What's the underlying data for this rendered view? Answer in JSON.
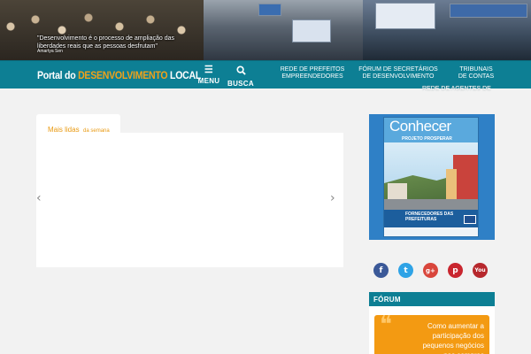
{
  "hero": {
    "quote": "\"Desenvolvimento é o processo de ampliação das liberdades reais que as pessoas desfrutam\"",
    "author": "Amartya Sen"
  },
  "navbar": {
    "logo_prefix": "Portal do ",
    "logo_accent": "DESENVOLVIMENTO",
    "logo_suffix": " LOCAL",
    "menu_label": "MENU",
    "menu_icon": "hamburger-icon",
    "search_label": "BUSCA",
    "search_icon": "search-icon",
    "links": [
      {
        "line1": "REDE DE PREFEITOS",
        "line2": "EMPREENDEDORES"
      },
      {
        "line1": "FÓRUM DE SECRETÁRIOS",
        "line2": "DE DESENVOLVIMENTO"
      },
      {
        "line1": "TRIBUNAIS",
        "line2": "DE CONTAS"
      }
    ],
    "overflow_link": "REDE DE AGENTES DE"
  },
  "most_read": {
    "tab_title": "Mais lidas",
    "tab_subtitle": "da semana"
  },
  "carousel": {
    "prev_glyph": "‹",
    "next_glyph": "›"
  },
  "magazine": {
    "title": "Conhecer",
    "subtitle": "Projeto Prosperar",
    "cover_band": "Fornecedores das Prefeituras"
  },
  "social": {
    "facebook": "f",
    "twitter": "t",
    "googleplus": "g+",
    "pinterest": "p",
    "youtube": "You"
  },
  "forum": {
    "heading": "FÓRUM",
    "card_text": "Como aumentar a participação dos pequenos negócios nas compras governamentais"
  },
  "colors": {
    "nav_teal": "#0d7f94",
    "logo_accent": "#f0a21a",
    "tab_orange": "#e99a12",
    "forum_card": "#f39a12"
  }
}
